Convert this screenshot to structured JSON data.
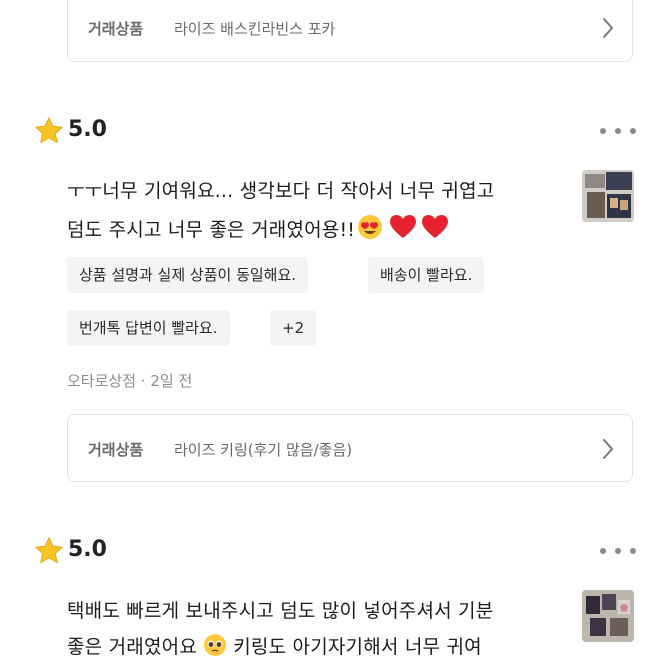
{
  "product_cards": [
    {
      "label": "거래상품",
      "name": "라이즈 배스킨라빈스 포카"
    },
    {
      "label": "거래상품",
      "name": "라이즈 키링(후기 많음/좋음)"
    }
  ],
  "reviews": [
    {
      "rating": "5.0",
      "text_lines": [
        "ㅜㅜ너무 기여워요... 생각보다 더 작아서 너무 귀엽고",
        "덤도 주시고 너무 좋은 거래였어용!!"
      ],
      "tags": [
        "상품 설명과 실제 상품이 동일해요.",
        "배송이 빨라요.",
        "번개톡 답변이 빨라요.",
        "+2"
      ],
      "shop": "오타로상점",
      "time": "· 2일 전"
    },
    {
      "rating": "5.0",
      "text_lines": [
        "택배도 빠르게 보내주시고 덤도 많이 넣어주셔서 기분",
        "좋은 거래였어요",
        " 키링도 아기자기해서 너무 귀여"
      ]
    }
  ],
  "icons": {
    "star": "star-icon",
    "more": "more-options-icon",
    "chevron": "chevron-right-icon",
    "emoji_heart_eyes": "heart-eyes-emoji",
    "heart": "red-heart-emoji",
    "pleading": "pleading-face-emoji"
  },
  "colors": {
    "star": "#f7c325",
    "heart": "#e5232e",
    "muted": "#8c8c8c",
    "tag_bg": "#f4f4f4"
  }
}
